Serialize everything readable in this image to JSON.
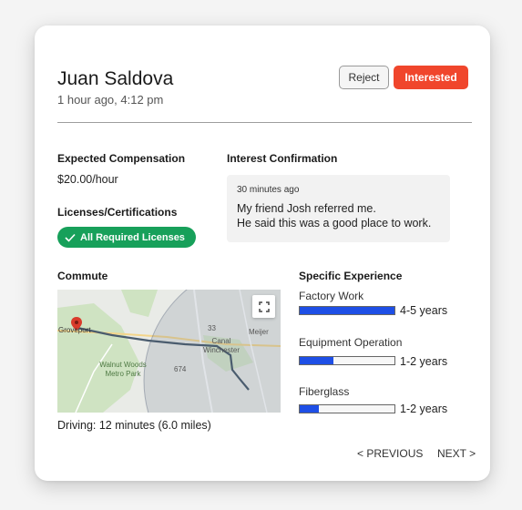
{
  "candidate": {
    "name": "Juan Saldova",
    "time": "1 hour ago, 4:12 pm"
  },
  "actions": {
    "reject": "Reject",
    "interested": "Interested"
  },
  "compensation": {
    "label": "Expected Compensation",
    "value": "$20.00/hour"
  },
  "licenses": {
    "label": "Licenses/Certifications",
    "badge": "All Required Licenses"
  },
  "interest": {
    "label": "Interest Confirmation",
    "time": "30 minutes ago",
    "line1": "My friend Josh referred me.",
    "line2": "He said this was a good place to work."
  },
  "commute": {
    "label": "Commute",
    "summary": "Driving: 12 minutes (6.0 miles)",
    "map": {
      "place1": "Groveport",
      "place2": "Canal Winchester",
      "place3": "Walnut Woods Metro Park",
      "place4": "Meijer",
      "road1": "33",
      "road2": "674"
    }
  },
  "experience": {
    "label": "Specific Experience",
    "items": [
      {
        "name": "Factory Work",
        "text": "4-5 years",
        "level": 1.0
      },
      {
        "name": "Equipment Operation",
        "text": "1-2 years",
        "level": 0.36
      },
      {
        "name": "Fiberglass",
        "text": "1-2 years",
        "level": 0.2
      }
    ]
  },
  "navigation": {
    "previous": "< PREVIOUS",
    "next": "NEXT >"
  },
  "colors": {
    "accent": "#f0462c",
    "badge": "#17a05a",
    "bar": "#1e4fe6"
  }
}
